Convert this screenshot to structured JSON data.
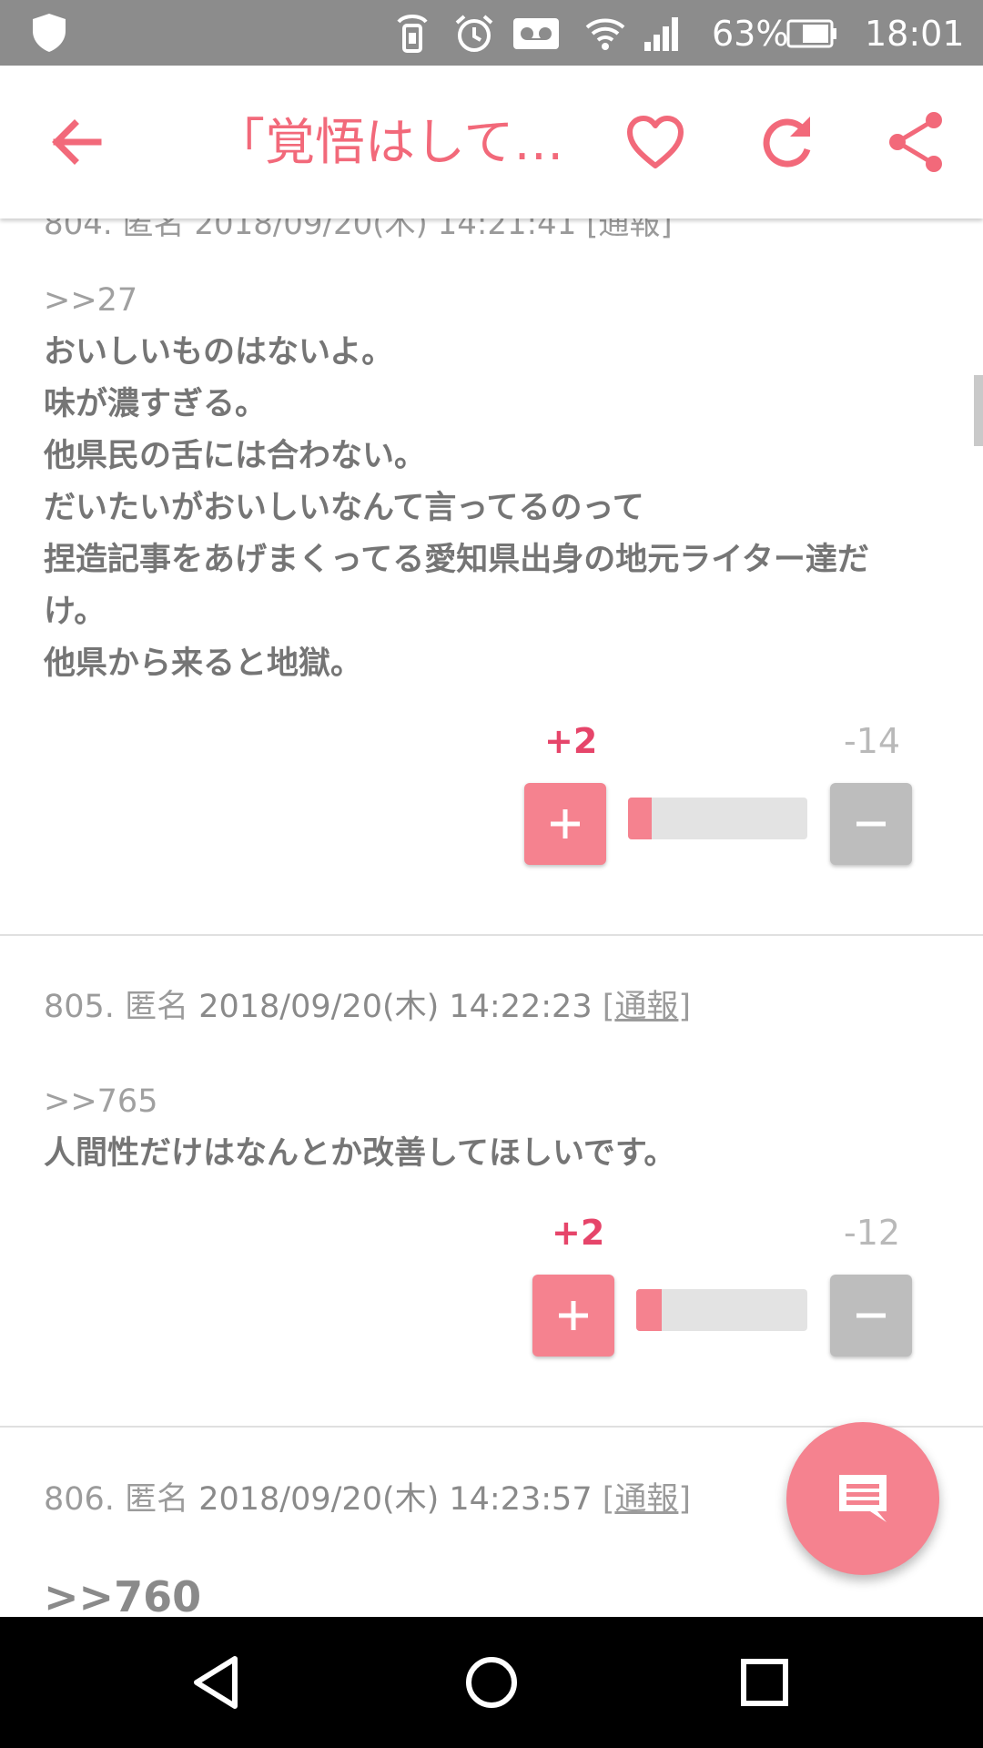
{
  "status_bar": {
    "battery": "63%",
    "time": "18:01",
    "icons": [
      "shield-icon",
      "nfc-icon",
      "alarm-icon",
      "voicemail-icon",
      "wifi-icon",
      "signal-icon",
      "battery-icon"
    ]
  },
  "app_bar": {
    "title": "「覚悟はして…",
    "icons": [
      "back-arrow-icon",
      "heart-icon",
      "refresh-icon",
      "share-icon"
    ]
  },
  "accent_color": "#f2697a",
  "posts": [
    {
      "anchor": ">>27",
      "lines": [
        "おいしいものはないよ。",
        "味が濃すぎる。",
        "他県民の舌には合わない。",
        "だいたいがおいしいなんて言ってるのって",
        "捏造記事をあげまくってる愛知県出身の地元ライター達だ",
        "け。",
        "他県から来ると地獄。"
      ],
      "plus": "+2",
      "minus": "-14",
      "plus_ratio": 0.13
    },
    {
      "number": "805.",
      "name": "匿名",
      "date": "2018/09/20(木) 14:22:23",
      "report": "通報",
      "anchor": ">>765",
      "lines": [
        "人間性だけはなんとか改善してほしいです。"
      ],
      "plus": "+2",
      "minus": "-12",
      "plus_ratio": 0.15
    },
    {
      "number": "806.",
      "name": "匿名",
      "date": "2018/09/20(木) 14:23:57",
      "report": "通報",
      "anchor": ">>760"
    }
  ],
  "fab": {
    "icon": "comment-icon"
  },
  "nav_bar": {
    "icons": [
      "back-triangle-icon",
      "home-circle-icon",
      "recents-square-icon"
    ]
  }
}
